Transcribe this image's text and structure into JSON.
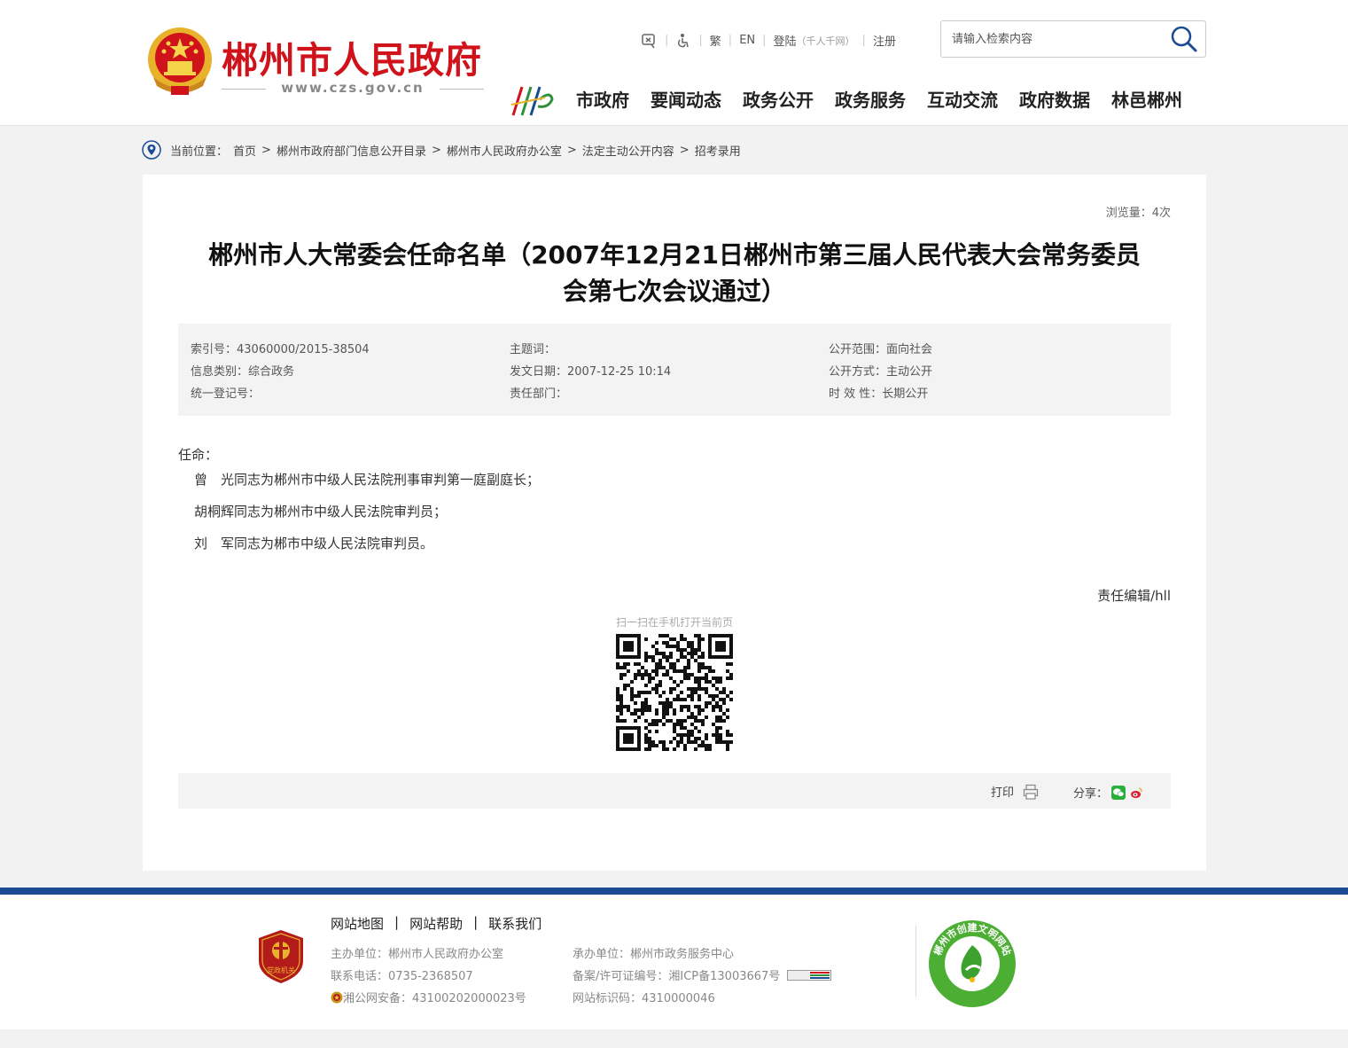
{
  "header": {
    "site_title": "郴州市人民政府",
    "site_url": "www.czs.gov.cn",
    "toplinks": {
      "traditional": "繁",
      "english": "EN",
      "login": "登陆",
      "login_note": "（千人千网）",
      "register": "注册"
    },
    "search": {
      "placeholder": "请输入检索内容"
    },
    "nav": [
      "市政府",
      "要闻动态",
      "政务公开",
      "政务服务",
      "互动交流",
      "政府数据",
      "林邑郴州"
    ]
  },
  "breadcrumb": {
    "label": "当前位置：",
    "items": [
      "首页",
      "郴州市政府部门信息公开目录",
      "郴州市人民政府办公室",
      "法定主动公开内容",
      "招考录用"
    ]
  },
  "article": {
    "views": "浏览量：4次",
    "title_line1": "郴州市人大常委会任命名单（2007年12月21日郴州市第三届人民代表大会常务委员",
    "title_line2": "会第七次会议通过）",
    "meta": {
      "index_no": "索引号：43060000/2015-38504",
      "category": "信息类别：综合政务",
      "reg_no": "统一登记号：",
      "subject": "主题词：",
      "date": "发文日期：2007-12-25 10:14",
      "dept": "责任部门：",
      "scope": "公开范围：面向社会",
      "method": "公开方式：主动公开",
      "validity": "时 效 性：长期公开"
    },
    "body": [
      "任命：",
      "曾　光同志为郴州市中级人民法院刑事审判第一庭副庭长；",
      "胡桐辉同志为郴州市中级人民法院审判员；",
      "刘　军同志为郴市中级人民法院审判员。"
    ],
    "editor": "责任编辑/hll",
    "qr_caption": "扫一扫在手机打开当前页",
    "print": "打印",
    "share": "分享："
  },
  "footer": {
    "links": [
      "网站地图",
      "网站帮助",
      "联系我们"
    ],
    "sponsor": "主办单位：郴州市人民政府办公室",
    "phone": "联系电话：0735-2368507",
    "police": "湘公网安备：43100202000023号",
    "organizer": "承办单位：郴州市政务服务中心",
    "icp": "备案/许可证编号：湘ICP备13003667号",
    "site_id": "网站标识码：4310000046",
    "party_badge": "党政机关",
    "civil_badge": "郴州市创建文明网站"
  },
  "colors": {
    "brand_red": "#d0121b",
    "footer_blue": "#1b4b93"
  }
}
